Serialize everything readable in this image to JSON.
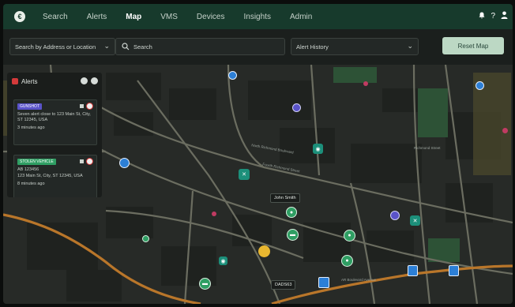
{
  "nav": {
    "logo": "€",
    "items": [
      {
        "label": "Search",
        "active": false
      },
      {
        "label": "Alerts",
        "active": false
      },
      {
        "label": "Map",
        "active": true
      },
      {
        "label": "VMS",
        "active": false
      },
      {
        "label": "Devices",
        "active": false
      },
      {
        "label": "Insights",
        "active": false
      },
      {
        "label": "Admin",
        "active": false
      }
    ],
    "help": "?"
  },
  "toolbar": {
    "search_by": "Search by Address or Location",
    "search_placeholder": "Search",
    "history": "Alert History",
    "reset": "Reset Map"
  },
  "alerts_panel": {
    "title": "Alerts",
    "cards": [
      {
        "badge": "GUNSHOT",
        "badge_color": "#5a53c9",
        "text": "Seven alert close to 123 Main St, City, ST 12345, USA",
        "time": "3 minutes ago"
      },
      {
        "badge": "STOLEN VEHICLE",
        "badge_color": "#2f9e63",
        "plate": "AB 123456",
        "text": "123 Main St, City, ST 12345, USA",
        "time": "8 minutes ago"
      }
    ]
  },
  "map": {
    "tooltips": [
      "John Smith",
      "DADS63"
    ],
    "streets": [
      "North Richmond Boulevard",
      "Fourth Richmond Street",
      "Richmond Street",
      "AR Boulevard Avenue"
    ]
  },
  "colors": {
    "nav_bg": "#173a2c",
    "accent": "#bcd8c4",
    "alert_red": "#d43a3a"
  }
}
